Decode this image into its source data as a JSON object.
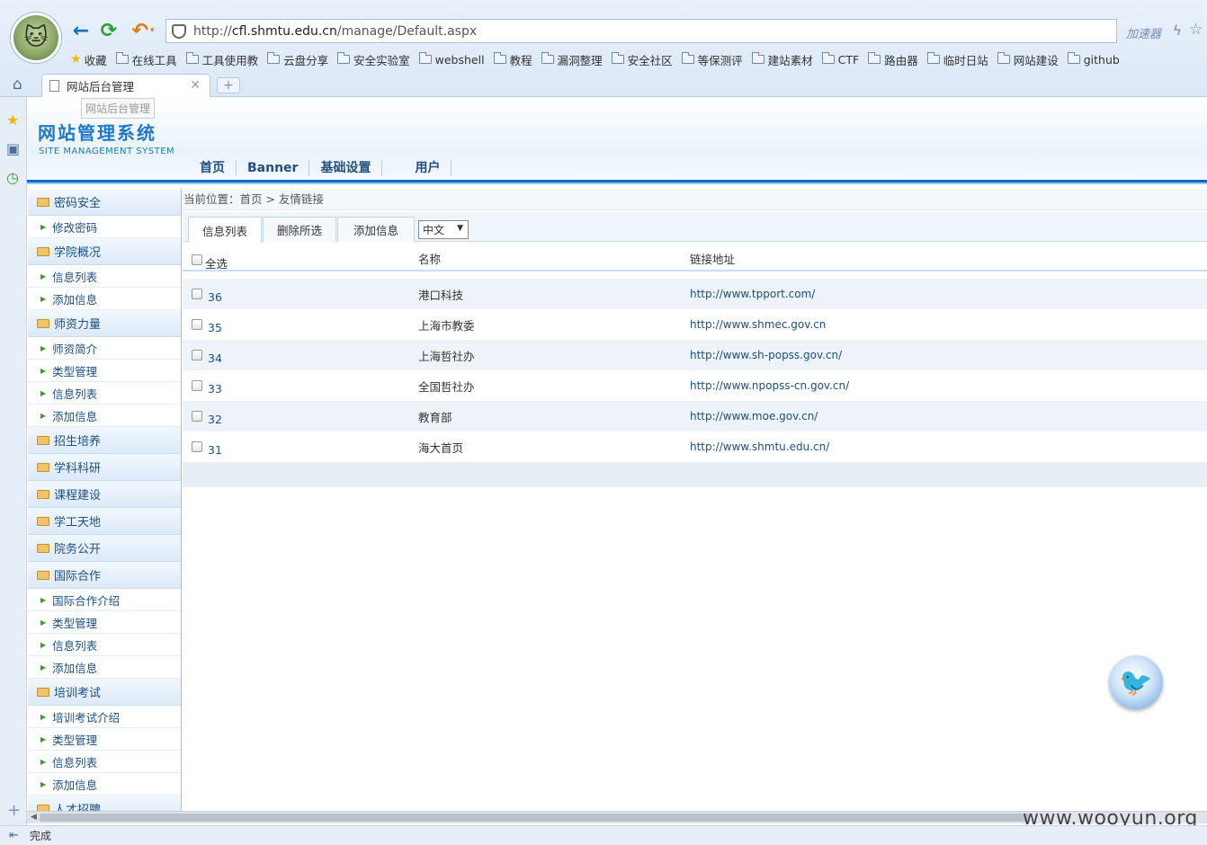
{
  "browser": {
    "url_prefix": "http://",
    "url_host": "cfl.shmtu.edu.cn",
    "url_path": "/manage/Default.aspx",
    "accelerator_label": "加速器",
    "tab_title": "网站后台管理",
    "tooltip": "网站后台管理",
    "bookmarks": [
      "收藏",
      "在线工具",
      "工具使用教",
      "云盘分享",
      "安全实验室",
      "webshell",
      "教程",
      "漏洞整理",
      "安全社区",
      "等保测评",
      "建站素材",
      "CTF",
      "路由器",
      "临时日站",
      "网站建设",
      "github"
    ],
    "status_text": "完成"
  },
  "header": {
    "title": "网站管理系统",
    "subtitle": "SITE MANAGEMENT SYSTEM",
    "nav": [
      "首页",
      "Banner",
      "基础设置",
      "用户"
    ]
  },
  "sidebar": {
    "groups": [
      {
        "label": "密码安全",
        "items": [
          "修改密码"
        ]
      },
      {
        "label": "学院概况",
        "items": [
          "信息列表",
          "添加信息"
        ]
      },
      {
        "label": "师资力量",
        "items": [
          "师资简介",
          "类型管理",
          "信息列表",
          "添加信息"
        ]
      },
      {
        "label": "招生培养",
        "items": []
      },
      {
        "label": "学科科研",
        "items": []
      },
      {
        "label": "课程建设",
        "items": []
      },
      {
        "label": "学工天地",
        "items": []
      },
      {
        "label": "院务公开",
        "items": []
      },
      {
        "label": "国际合作",
        "items": [
          "国际合作介绍",
          "类型管理",
          "信息列表",
          "添加信息"
        ]
      },
      {
        "label": "培训考试",
        "items": [
          "培训考试介绍",
          "类型管理",
          "信息列表",
          "添加信息"
        ]
      },
      {
        "label": "人才招聘",
        "items": []
      }
    ]
  },
  "main": {
    "breadcrumb": "当前位置：首页 > 友情链接",
    "tabs": [
      "信息列表",
      "删除所选",
      "添加信息"
    ],
    "language": "中文",
    "columns": {
      "select_all": "全选",
      "name": "名称",
      "url": "链接地址"
    },
    "rows": [
      {
        "id": "36",
        "name": "港口科技",
        "url": "http://www.tpport.com/"
      },
      {
        "id": "35",
        "name": "上海市教委",
        "url": "http://www.shmec.gov.cn"
      },
      {
        "id": "34",
        "name": "上海哲社办",
        "url": "http://www.sh-popss.gov.cn/"
      },
      {
        "id": "33",
        "name": "全国哲社办",
        "url": "http://www.npopss-cn.gov.cn/"
      },
      {
        "id": "32",
        "name": "教育部",
        "url": "http://www.moe.gov.cn/"
      },
      {
        "id": "31",
        "name": "海大首页",
        "url": "http://www.shmtu.edu.cn/"
      }
    ]
  },
  "watermark": "www.wooyun.org"
}
